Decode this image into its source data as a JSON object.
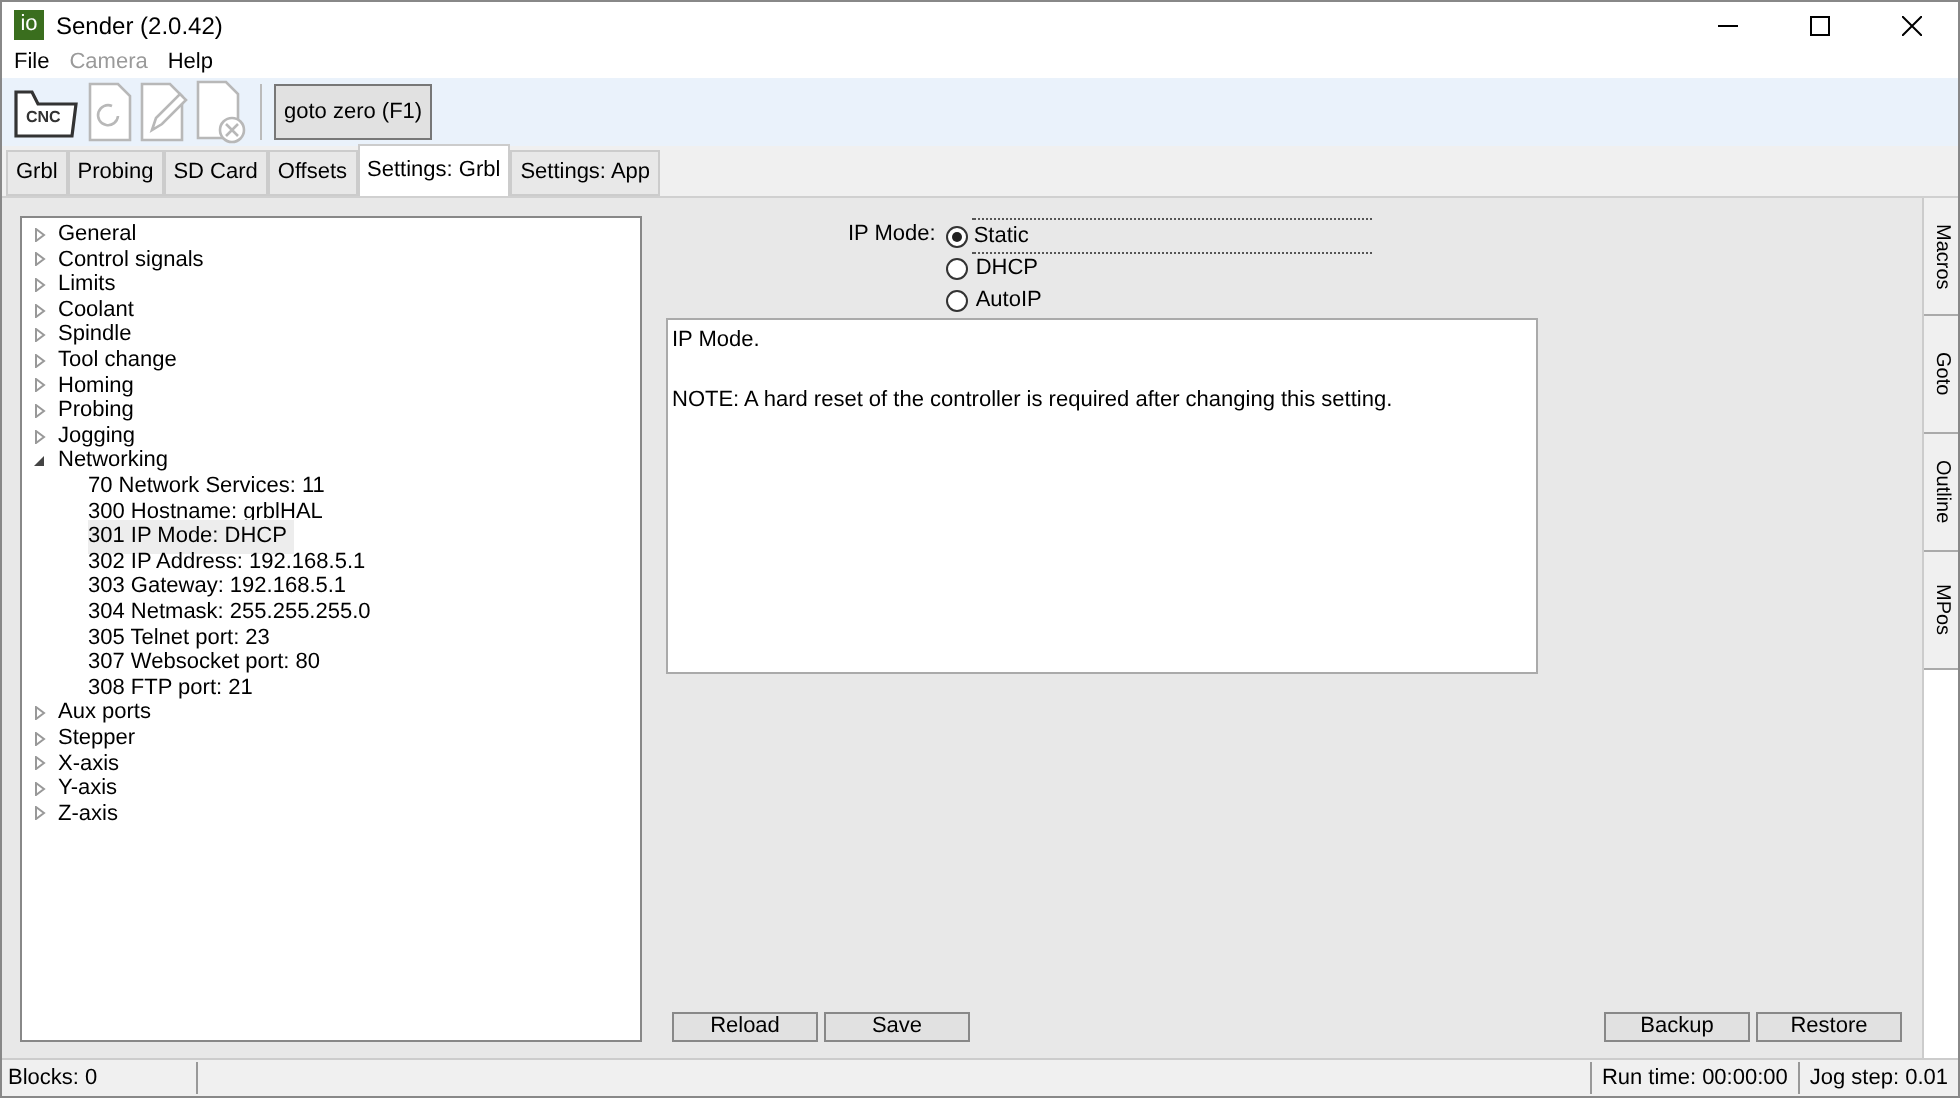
{
  "window": {
    "title": "Sender (2.0.42)",
    "logo": "io"
  },
  "menu": [
    {
      "label": "File",
      "disabled": false
    },
    {
      "label": "Camera",
      "disabled": true
    },
    {
      "label": "Help",
      "disabled": false
    }
  ],
  "toolbar": {
    "tools": [
      {
        "kind": "open",
        "label": "CNC",
        "disabled": false
      },
      {
        "kind": "reload",
        "disabled": true
      },
      {
        "kind": "edit",
        "disabled": true
      },
      {
        "kind": "close",
        "disabled": true
      }
    ],
    "button": "goto zero (F1)"
  },
  "tabs": [
    {
      "label": "Grbl",
      "selected": false
    },
    {
      "label": "Probing",
      "selected": false
    },
    {
      "label": "SD Card",
      "selected": false
    },
    {
      "label": "Offsets",
      "selected": false
    },
    {
      "label": "Settings: Grbl",
      "selected": true
    },
    {
      "label": "Settings: App",
      "selected": false
    }
  ],
  "tree": [
    {
      "label": "General",
      "expanded": false
    },
    {
      "label": "Control signals",
      "expanded": false
    },
    {
      "label": "Limits",
      "expanded": false
    },
    {
      "label": "Coolant",
      "expanded": false
    },
    {
      "label": "Spindle",
      "expanded": false
    },
    {
      "label": "Tool change",
      "expanded": false
    },
    {
      "label": "Homing",
      "expanded": false
    },
    {
      "label": "Probing",
      "expanded": false
    },
    {
      "label": "Jogging",
      "expanded": false
    },
    {
      "label": "Networking",
      "expanded": true,
      "children": [
        {
          "label": "70 Network Services: 11",
          "selected": false
        },
        {
          "label": "300 Hostname: grblHAL",
          "selected": false
        },
        {
          "label": "301 IP Mode: DHCP",
          "selected": true
        },
        {
          "label": "302 IP Address: 192.168.5.1",
          "selected": false
        },
        {
          "label": "303 Gateway: 192.168.5.1",
          "selected": false
        },
        {
          "label": "304 Netmask: 255.255.255.0",
          "selected": false
        },
        {
          "label": "305 Telnet port: 23",
          "selected": false
        },
        {
          "label": "307 Websocket port: 80",
          "selected": false
        },
        {
          "label": "308 FTP port: 21",
          "selected": false
        }
      ]
    },
    {
      "label": "Aux ports",
      "expanded": false
    },
    {
      "label": "Stepper",
      "expanded": false
    },
    {
      "label": "X-axis",
      "expanded": false
    },
    {
      "label": "Y-axis",
      "expanded": false
    },
    {
      "label": "Z-axis",
      "expanded": false
    }
  ],
  "setting": {
    "label": "IP Mode:",
    "options": [
      {
        "label": "Static",
        "selected": true
      },
      {
        "label": "DHCP",
        "selected": false
      },
      {
        "label": "AutoIP",
        "selected": false
      }
    ],
    "description": [
      "IP Mode.",
      "NOTE: A hard reset of the controller is required after changing this setting."
    ]
  },
  "left_buttons": [
    "Reload",
    "Save"
  ],
  "right_buttons": [
    "Backup",
    "Restore"
  ],
  "side_tabs": [
    "Macros",
    "Goto",
    "Outline",
    "MPos"
  ],
  "status_bar": {
    "blocks": "Blocks: 0",
    "run_time": "Run time: 00:00:00",
    "jog_step": "Jog step: 0.01"
  }
}
